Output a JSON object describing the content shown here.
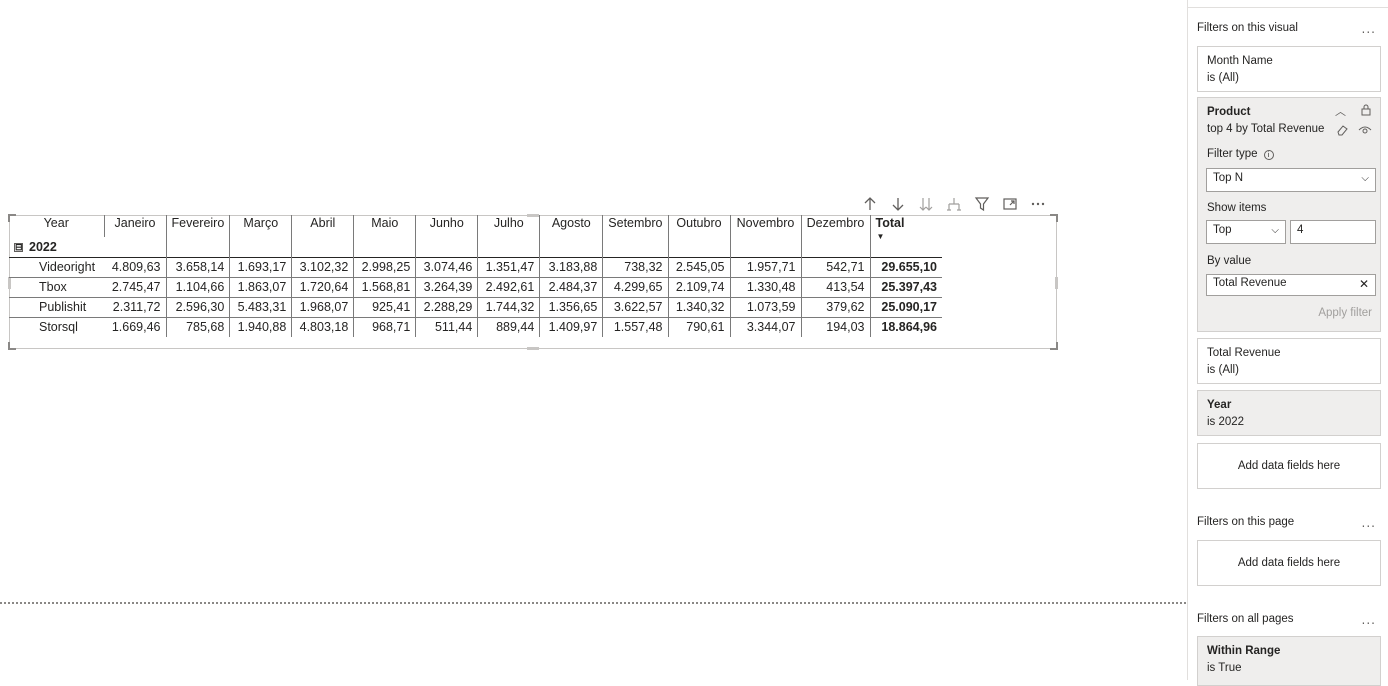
{
  "matrix": {
    "row_header": "Year",
    "columns": [
      "Janeiro",
      "Fevereiro",
      "Março",
      "Abril",
      "Maio",
      "Junho",
      "Julho",
      "Agosto",
      "Setembro",
      "Outubro",
      "Novembro",
      "Dezembro"
    ],
    "total_header": "Total",
    "group_label": "2022",
    "expand_symbol": "⊟",
    "rows": [
      {
        "label": "Videoright",
        "values": [
          "4.809,63",
          "3.658,14",
          "1.693,17",
          "3.102,32",
          "2.998,25",
          "3.074,46",
          "1.351,47",
          "3.183,88",
          "738,32",
          "2.545,05",
          "1.957,71",
          "542,71"
        ],
        "total": "29.655,10"
      },
      {
        "label": "Tbox",
        "values": [
          "2.745,47",
          "1.104,66",
          "1.863,07",
          "1.720,64",
          "1.568,81",
          "3.264,39",
          "2.492,61",
          "2.484,37",
          "4.299,65",
          "2.109,74",
          "1.330,48",
          "413,54"
        ],
        "total": "25.397,43"
      },
      {
        "label": "Publishit",
        "values": [
          "2.311,72",
          "2.596,30",
          "5.483,31",
          "1.968,07",
          "925,41",
          "2.288,29",
          "1.744,32",
          "1.356,65",
          "3.622,57",
          "1.340,32",
          "1.073,59",
          "379,62"
        ],
        "total": "25.090,17"
      },
      {
        "label": "Storsql",
        "values": [
          "1.669,46",
          "785,68",
          "1.940,88",
          "4.803,18",
          "968,71",
          "511,44",
          "889,44",
          "1.409,97",
          "1.557,48",
          "790,61",
          "3.344,07",
          "194,03"
        ],
        "total": "18.864,96"
      }
    ]
  },
  "visual_header": {
    "icons": [
      "arrow-up-icon",
      "arrow-down-icon",
      "double-arrow-down-icon",
      "hierarchy-expand-icon",
      "filter-icon",
      "focus-mode-icon",
      "more-options-icon"
    ]
  },
  "filters": {
    "visual_section_title": "Filters on this visual",
    "more": "...",
    "month": {
      "name": "Month Name",
      "state": "is (All)"
    },
    "product": {
      "name": "Product",
      "state": "top 4 by Total Revenue",
      "filter_type_label": "Filter type",
      "filter_type_value": "Top N",
      "show_items_label": "Show items",
      "show_items_direction": "Top",
      "show_items_count": "4",
      "by_value_label": "By value",
      "by_value_field": "Total Revenue",
      "apply_label": "Apply filter"
    },
    "total_revenue": {
      "name": "Total Revenue",
      "state": "is (All)"
    },
    "year": {
      "name": "Year",
      "state": "is 2022"
    },
    "add_fields_visual": "Add data fields here",
    "page_section_title": "Filters on this page",
    "add_fields_page": "Add data fields here",
    "all_pages_section_title": "Filters on all pages",
    "within_range": {
      "name": "Within Range",
      "state": "is True"
    }
  }
}
